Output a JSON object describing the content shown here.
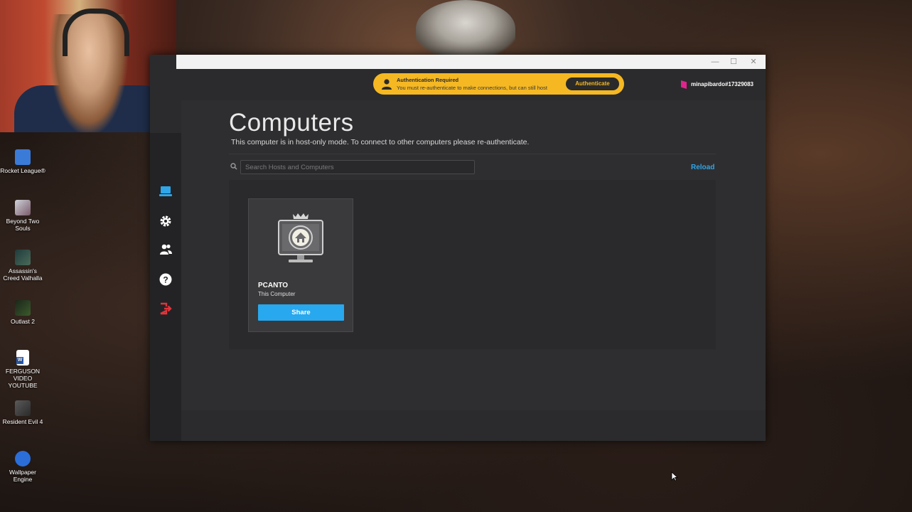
{
  "desktop": {
    "icons": [
      {
        "label": "Rocket League®",
        "color": "#3b7bd8"
      },
      {
        "label": "Beyond Two Souls",
        "color": "#8a8f9a"
      },
      {
        "label": "Assassin's Creed Valhalla",
        "color": "#2a4a4a"
      },
      {
        "label": "Outlast 2",
        "color": "#2c3a2a"
      },
      {
        "label": "FERGUSON VIDEO  YOUTUBE",
        "color": "#ffffff"
      },
      {
        "label": "Resident Evil 4",
        "color": "#4a4a4a"
      },
      {
        "label": "Wallpaper Engine",
        "color": "#2b6ed8"
      }
    ]
  },
  "window": {
    "controls": {
      "minimize": "—",
      "maximize": "☐",
      "close": "✕"
    }
  },
  "auth_banner": {
    "title": "Authentication Required",
    "message": "You must re-authenticate to make connections, but can still host",
    "button": "Authenticate",
    "color": "#f5b823"
  },
  "user": {
    "name": "minapibardo#17329083",
    "logo_color": "#e0248d"
  },
  "sidebar": {
    "items": [
      {
        "icon": "computer-icon",
        "active": true,
        "color": "#2fa6e8"
      },
      {
        "icon": "gear-icon",
        "color": "#ffffff"
      },
      {
        "icon": "friends-icon",
        "color": "#ffffff"
      },
      {
        "icon": "help-icon",
        "color": "#ffffff"
      },
      {
        "icon": "logout-icon",
        "color": "#e0343a"
      }
    ]
  },
  "main": {
    "title": "Computers",
    "subtitle": "This computer is in host-only mode. To connect to other computers please re-authenticate.",
    "search_placeholder": "Search Hosts and Computers",
    "reload": "Reload",
    "computers": [
      {
        "name": "PCANTO",
        "description": "This Computer",
        "action": "Share"
      }
    ]
  },
  "accent": "#28a8ee"
}
